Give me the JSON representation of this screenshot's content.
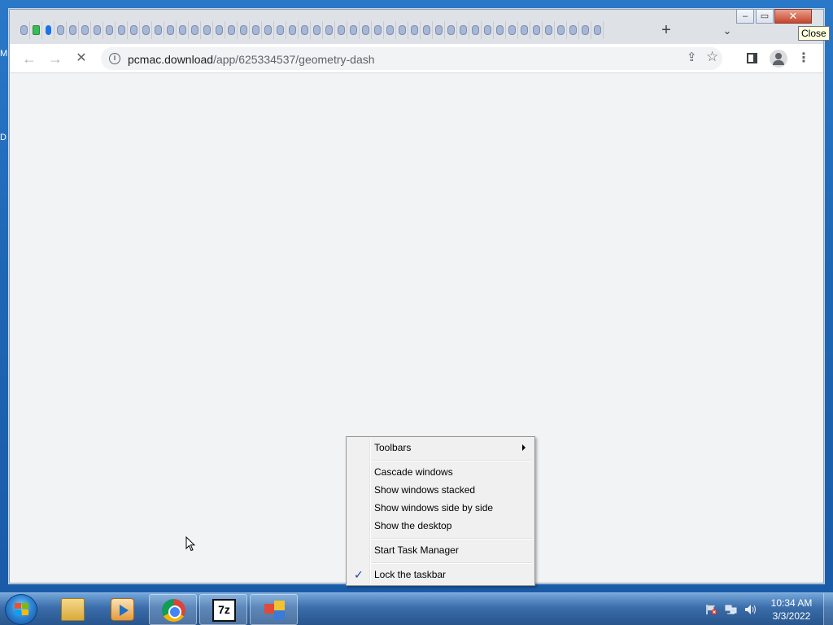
{
  "desktop": {
    "edge_labels": [
      "M",
      "D"
    ]
  },
  "browser": {
    "tab_count": 48,
    "new_tab_symbol": "+",
    "tab_list_symbol": "⌄",
    "window_controls": {
      "minimize": "–",
      "maximize": "▭",
      "close": "✕"
    },
    "tooltip": "Close",
    "nav": {
      "back": "←",
      "forward": "→",
      "stop": "✕"
    },
    "omnibox": {
      "host": "pcmac.download",
      "path": "/app/625334537/geometry-dash",
      "info_symbol": "i"
    },
    "page_loading": true
  },
  "context_menu": {
    "items": [
      {
        "label": "Toolbars",
        "submenu": true
      },
      {
        "label": "Cascade windows"
      },
      {
        "label": "Show windows stacked"
      },
      {
        "label": "Show windows side by side"
      },
      {
        "label": "Show the desktop"
      },
      {
        "label": "Start Task Manager"
      },
      {
        "label": "Lock the taskbar",
        "checked": true
      }
    ],
    "check_symbol": "✓"
  },
  "taskbar": {
    "pinned": [
      {
        "name": "windows-explorer",
        "active": false
      },
      {
        "name": "media-player",
        "active": false
      },
      {
        "name": "google-chrome",
        "active": true
      },
      {
        "name": "7-zip",
        "label": "7z",
        "active": true
      },
      {
        "name": "app",
        "active": true
      }
    ],
    "clock": {
      "time": "10:34 AM",
      "date": "3/3/2022"
    }
  },
  "colors": {
    "taskbar": "#2f5f9b",
    "menu_bg": "#f0f0f0",
    "check": "#1a3ea8"
  }
}
